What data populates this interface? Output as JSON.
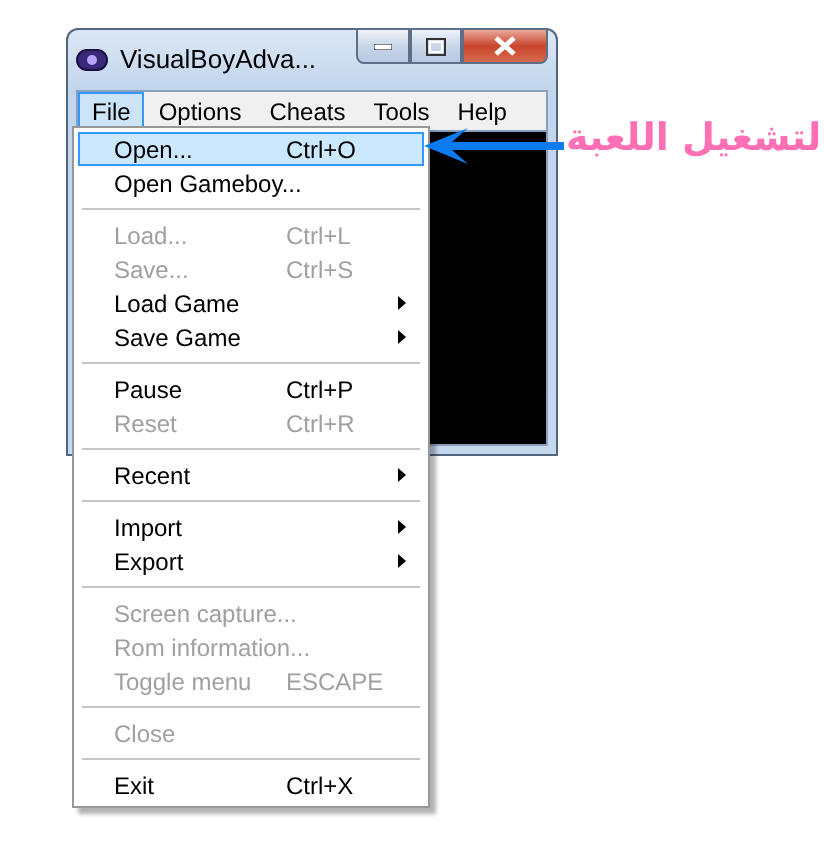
{
  "window": {
    "title": "VisualBoyAdva..."
  },
  "menu_bar": [
    {
      "label": "File",
      "selected": true
    },
    {
      "label": "Options",
      "selected": false
    },
    {
      "label": "Cheats",
      "selected": false
    },
    {
      "label": "Tools",
      "selected": false
    },
    {
      "label": "Help",
      "selected": false
    }
  ],
  "file_menu": [
    {
      "kind": "item",
      "label": "Open...",
      "shortcut": "Ctrl+O",
      "disabled": false,
      "selected": true,
      "submenu": false
    },
    {
      "kind": "item",
      "label": "Open Gameboy...",
      "disabled": false,
      "selected": false,
      "submenu": false
    },
    {
      "kind": "separator"
    },
    {
      "kind": "item",
      "label": "Load...",
      "shortcut": "Ctrl+L",
      "disabled": true,
      "selected": false,
      "submenu": false
    },
    {
      "kind": "item",
      "label": "Save...",
      "shortcut": "Ctrl+S",
      "disabled": true,
      "selected": false,
      "submenu": false
    },
    {
      "kind": "item",
      "label": "Load Game",
      "disabled": false,
      "selected": false,
      "submenu": true
    },
    {
      "kind": "item",
      "label": "Save Game",
      "disabled": false,
      "selected": false,
      "submenu": true
    },
    {
      "kind": "separator"
    },
    {
      "kind": "item",
      "label": "Pause",
      "shortcut": "Ctrl+P",
      "disabled": false,
      "selected": false,
      "submenu": false
    },
    {
      "kind": "item",
      "label": "Reset",
      "shortcut": "Ctrl+R",
      "disabled": true,
      "selected": false,
      "submenu": false
    },
    {
      "kind": "separator"
    },
    {
      "kind": "item",
      "label": "Recent",
      "disabled": false,
      "selected": false,
      "submenu": true
    },
    {
      "kind": "separator"
    },
    {
      "kind": "item",
      "label": "Import",
      "disabled": false,
      "selected": false,
      "submenu": true
    },
    {
      "kind": "item",
      "label": "Export",
      "disabled": false,
      "selected": false,
      "submenu": true
    },
    {
      "kind": "separator"
    },
    {
      "kind": "item",
      "label": "Screen capture...",
      "disabled": true,
      "selected": false,
      "submenu": false
    },
    {
      "kind": "item",
      "label": "Rom information...",
      "disabled": true,
      "selected": false,
      "submenu": false
    },
    {
      "kind": "item",
      "label": "Toggle menu",
      "shortcut": "ESCAPE",
      "disabled": true,
      "selected": false,
      "submenu": false
    },
    {
      "kind": "separator"
    },
    {
      "kind": "item",
      "label": "Close",
      "disabled": true,
      "selected": false,
      "submenu": false
    },
    {
      "kind": "separator"
    },
    {
      "kind": "item",
      "label": "Exit",
      "shortcut": "Ctrl+X",
      "disabled": false,
      "selected": false,
      "submenu": false
    }
  ],
  "annotation": {
    "text": "لتشغيل اللعبة"
  }
}
